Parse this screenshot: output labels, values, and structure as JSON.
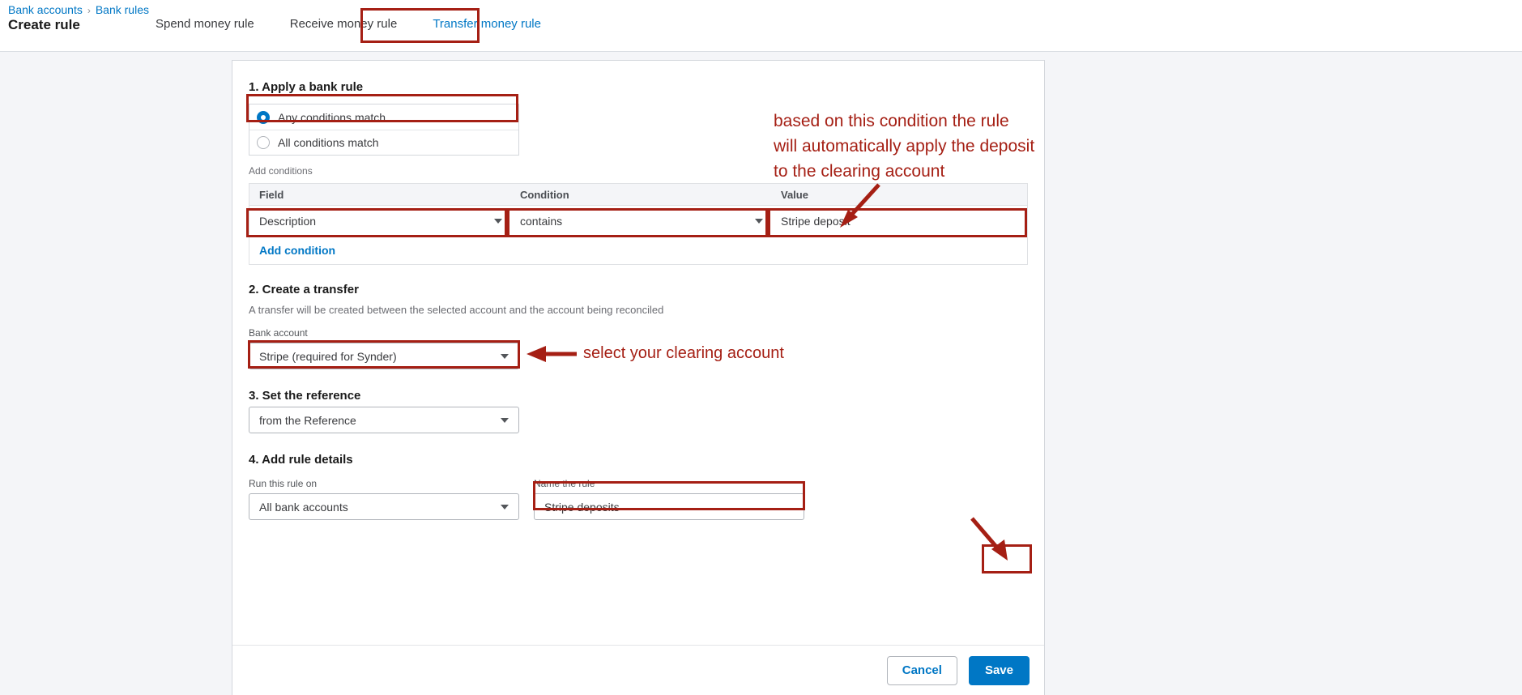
{
  "header": {
    "breadcrumb": [
      {
        "label": "Bank accounts"
      },
      {
        "label": "Bank rules"
      }
    ],
    "breadcrumb_separator": "›",
    "page_title": "Create rule",
    "tabs": [
      {
        "label": "Spend money rule",
        "active": false
      },
      {
        "label": "Receive money rule",
        "active": false
      },
      {
        "label": "Transfer money rule",
        "active": true
      }
    ]
  },
  "section1": {
    "title": "1. Apply a bank rule",
    "options": [
      {
        "label": "Any conditions match",
        "selected": true
      },
      {
        "label": "All conditions match",
        "selected": false
      }
    ],
    "add_conditions_label": "Add conditions",
    "table": {
      "headers": [
        "Field",
        "Condition",
        "Value"
      ],
      "rows": [
        {
          "field": "Description",
          "condition": "contains",
          "value": "Stripe deposit"
        }
      ]
    },
    "add_condition_link": "Add condition"
  },
  "section2": {
    "title": "2. Create a transfer",
    "description": "A transfer will be created between the selected account and the account being reconciled",
    "bank_account_label": "Bank account",
    "bank_account_value": "Stripe (required for Synder)"
  },
  "section3": {
    "title": "3. Set the reference",
    "reference_value": "from the Reference"
  },
  "section4": {
    "title": "4. Add rule details",
    "run_on_label": "Run this rule on",
    "run_on_value": "All bank accounts",
    "name_label": "Name the rule",
    "name_value": "Stripe deposits"
  },
  "footer": {
    "cancel_label": "Cancel",
    "save_label": "Save"
  },
  "annotations": [
    {
      "text": "based on this condition the rule\nwill automatically apply the deposit\nto the clearing account"
    },
    {
      "text": "select your clearing account"
    }
  ],
  "colors": {
    "accent_blue": "#0077c5",
    "annotation_red": "#a51f14",
    "page_bg": "#f4f5f8"
  }
}
